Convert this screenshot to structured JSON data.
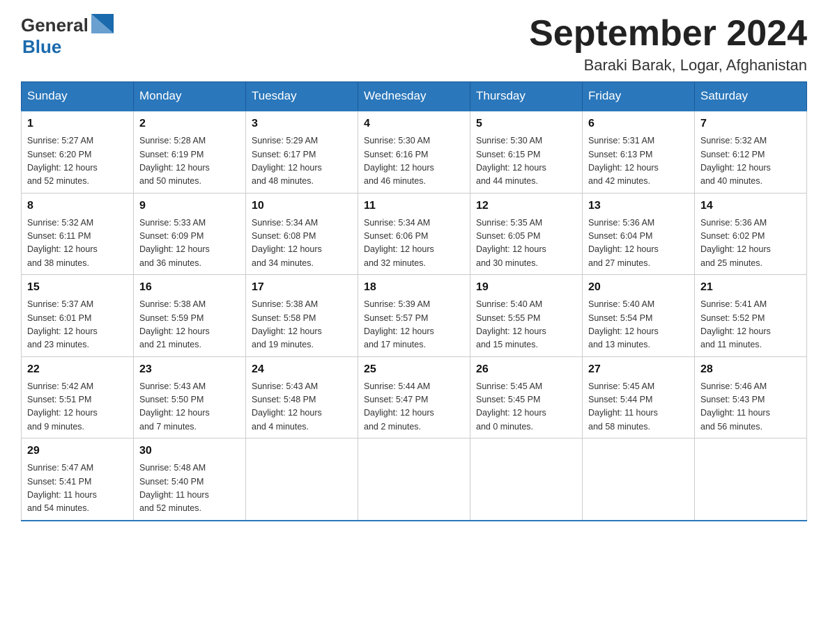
{
  "logo": {
    "text_general": "General",
    "text_blue": "Blue"
  },
  "header": {
    "title": "September 2024",
    "subtitle": "Baraki Barak, Logar, Afghanistan"
  },
  "days_of_week": [
    "Sunday",
    "Monday",
    "Tuesday",
    "Wednesday",
    "Thursday",
    "Friday",
    "Saturday"
  ],
  "weeks": [
    [
      {
        "num": "1",
        "sunrise": "5:27 AM",
        "sunset": "6:20 PM",
        "daylight_h": "12",
        "daylight_m": "52"
      },
      {
        "num": "2",
        "sunrise": "5:28 AM",
        "sunset": "6:19 PM",
        "daylight_h": "12",
        "daylight_m": "50"
      },
      {
        "num": "3",
        "sunrise": "5:29 AM",
        "sunset": "6:17 PM",
        "daylight_h": "12",
        "daylight_m": "48"
      },
      {
        "num": "4",
        "sunrise": "5:30 AM",
        "sunset": "6:16 PM",
        "daylight_h": "12",
        "daylight_m": "46"
      },
      {
        "num": "5",
        "sunrise": "5:30 AM",
        "sunset": "6:15 PM",
        "daylight_h": "12",
        "daylight_m": "44"
      },
      {
        "num": "6",
        "sunrise": "5:31 AM",
        "sunset": "6:13 PM",
        "daylight_h": "12",
        "daylight_m": "42"
      },
      {
        "num": "7",
        "sunrise": "5:32 AM",
        "sunset": "6:12 PM",
        "daylight_h": "12",
        "daylight_m": "40"
      }
    ],
    [
      {
        "num": "8",
        "sunrise": "5:32 AM",
        "sunset": "6:11 PM",
        "daylight_h": "12",
        "daylight_m": "38"
      },
      {
        "num": "9",
        "sunrise": "5:33 AM",
        "sunset": "6:09 PM",
        "daylight_h": "12",
        "daylight_m": "36"
      },
      {
        "num": "10",
        "sunrise": "5:34 AM",
        "sunset": "6:08 PM",
        "daylight_h": "12",
        "daylight_m": "34"
      },
      {
        "num": "11",
        "sunrise": "5:34 AM",
        "sunset": "6:06 PM",
        "daylight_h": "12",
        "daylight_m": "32"
      },
      {
        "num": "12",
        "sunrise": "5:35 AM",
        "sunset": "6:05 PM",
        "daylight_h": "12",
        "daylight_m": "30"
      },
      {
        "num": "13",
        "sunrise": "5:36 AM",
        "sunset": "6:04 PM",
        "daylight_h": "12",
        "daylight_m": "27"
      },
      {
        "num": "14",
        "sunrise": "5:36 AM",
        "sunset": "6:02 PM",
        "daylight_h": "12",
        "daylight_m": "25"
      }
    ],
    [
      {
        "num": "15",
        "sunrise": "5:37 AM",
        "sunset": "6:01 PM",
        "daylight_h": "12",
        "daylight_m": "23"
      },
      {
        "num": "16",
        "sunrise": "5:38 AM",
        "sunset": "5:59 PM",
        "daylight_h": "12",
        "daylight_m": "21"
      },
      {
        "num": "17",
        "sunrise": "5:38 AM",
        "sunset": "5:58 PM",
        "daylight_h": "12",
        "daylight_m": "19"
      },
      {
        "num": "18",
        "sunrise": "5:39 AM",
        "sunset": "5:57 PM",
        "daylight_h": "12",
        "daylight_m": "17"
      },
      {
        "num": "19",
        "sunrise": "5:40 AM",
        "sunset": "5:55 PM",
        "daylight_h": "12",
        "daylight_m": "15"
      },
      {
        "num": "20",
        "sunrise": "5:40 AM",
        "sunset": "5:54 PM",
        "daylight_h": "12",
        "daylight_m": "13"
      },
      {
        "num": "21",
        "sunrise": "5:41 AM",
        "sunset": "5:52 PM",
        "daylight_h": "12",
        "daylight_m": "11"
      }
    ],
    [
      {
        "num": "22",
        "sunrise": "5:42 AM",
        "sunset": "5:51 PM",
        "daylight_h": "12",
        "daylight_m": "9"
      },
      {
        "num": "23",
        "sunrise": "5:43 AM",
        "sunset": "5:50 PM",
        "daylight_h": "12",
        "daylight_m": "7"
      },
      {
        "num": "24",
        "sunrise": "5:43 AM",
        "sunset": "5:48 PM",
        "daylight_h": "12",
        "daylight_m": "4"
      },
      {
        "num": "25",
        "sunrise": "5:44 AM",
        "sunset": "5:47 PM",
        "daylight_h": "12",
        "daylight_m": "2"
      },
      {
        "num": "26",
        "sunrise": "5:45 AM",
        "sunset": "5:45 PM",
        "daylight_h": "12",
        "daylight_m": "0"
      },
      {
        "num": "27",
        "sunrise": "5:45 AM",
        "sunset": "5:44 PM",
        "daylight_h": "11",
        "daylight_m": "58"
      },
      {
        "num": "28",
        "sunrise": "5:46 AM",
        "sunset": "5:43 PM",
        "daylight_h": "11",
        "daylight_m": "56"
      }
    ],
    [
      {
        "num": "29",
        "sunrise": "5:47 AM",
        "sunset": "5:41 PM",
        "daylight_h": "11",
        "daylight_m": "54"
      },
      {
        "num": "30",
        "sunrise": "5:48 AM",
        "sunset": "5:40 PM",
        "daylight_h": "11",
        "daylight_m": "52"
      },
      null,
      null,
      null,
      null,
      null
    ]
  ]
}
